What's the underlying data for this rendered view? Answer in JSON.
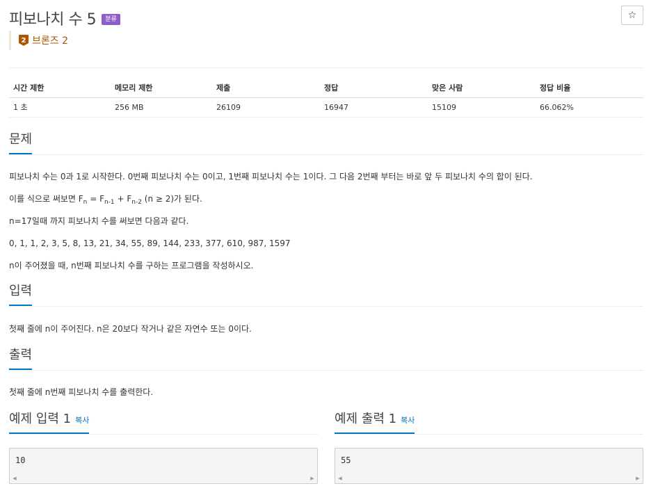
{
  "problem": {
    "title": "피보나치 수 5",
    "badge": "분류",
    "star": "☆",
    "tier_number": "2",
    "tier_label": "브론즈 2",
    "tier_color": "#ad5600"
  },
  "stats": {
    "headers": [
      "시간 제한",
      "메모리 제한",
      "제출",
      "정답",
      "맞은 사람",
      "정답 비율"
    ],
    "values": [
      "1 초",
      "256 MB",
      "26109",
      "16947",
      "15109",
      "66.062%"
    ]
  },
  "sections": {
    "problem_title": "문제",
    "problem_lines": {
      "l1": "피보나치 수는 0과 1로 시작한다. 0번째 피보나치 수는 0이고, 1번째 피보나치 수는 1이다. 그 다음 2번째 부터는 바로 앞 두 피보나치 수의 합이 된다.",
      "l2_prefix": "이를 식으로 써보면 F",
      "l2_sub1": "n",
      "l2_mid1": " = F",
      "l2_sub2": "n-1",
      "l2_mid2": " + F",
      "l2_sub3": "n-2",
      "l2_suffix": " (n ≥ 2)가 된다.",
      "l3": "n=17일때 까지 피보나치 수를 써보면 다음과 같다.",
      "l4": "0, 1, 1, 2, 3, 5, 8, 13, 21, 34, 55, 89, 144, 233, 377, 610, 987, 1597",
      "l5": "n이 주어졌을 때, n번째 피보나치 수를 구하는 프로그램을 작성하시오."
    },
    "input_title": "입력",
    "input_text": "첫째 줄에 n이 주어진다. n은 20보다 작거나 같은 자연수 또는 0이다.",
    "output_title": "출력",
    "output_text": "첫째 줄에 n번째 피보나치 수를 출력한다."
  },
  "samples": {
    "input_title": "예제 입력 1",
    "output_title": "예제 출력 1",
    "copy_label": "복사",
    "input_value": "10",
    "output_value": "55"
  },
  "colors": {
    "accent": "#0076c0",
    "badge": "#8e5ec6",
    "bronze": "#ad5600"
  }
}
